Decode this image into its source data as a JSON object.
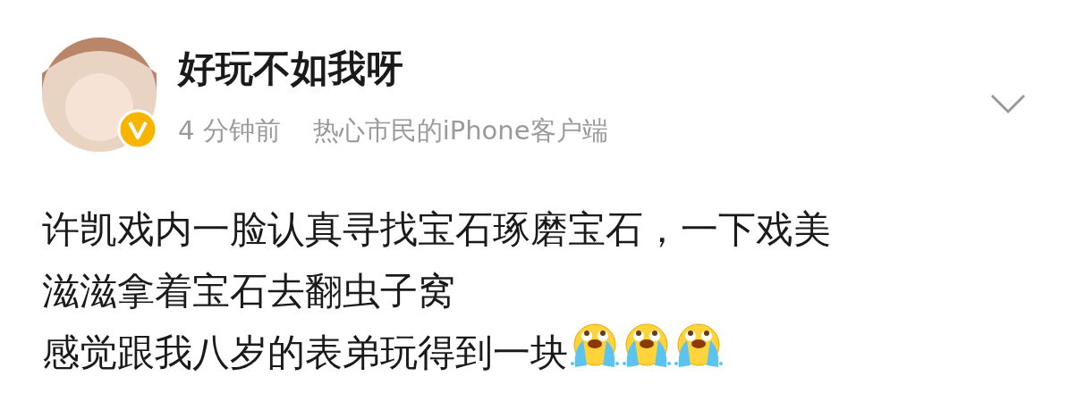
{
  "post": {
    "username": "好玩不如我呀",
    "verified": true,
    "time": "4 分钟前",
    "source": "热心市民的iPhone客户端",
    "lines": [
      {
        "text": "许凯戏内一脸认真寻找宝石琢磨宝石，一下戏美"
      },
      {
        "text": "滋滋拿着宝石去翻虫子窝"
      },
      {
        "text": "感觉跟我八岁的表弟玩得到一块",
        "emojis": [
          {
            "kind": "crying"
          },
          {
            "kind": "crying"
          },
          {
            "kind": "crying"
          }
        ]
      }
    ]
  }
}
